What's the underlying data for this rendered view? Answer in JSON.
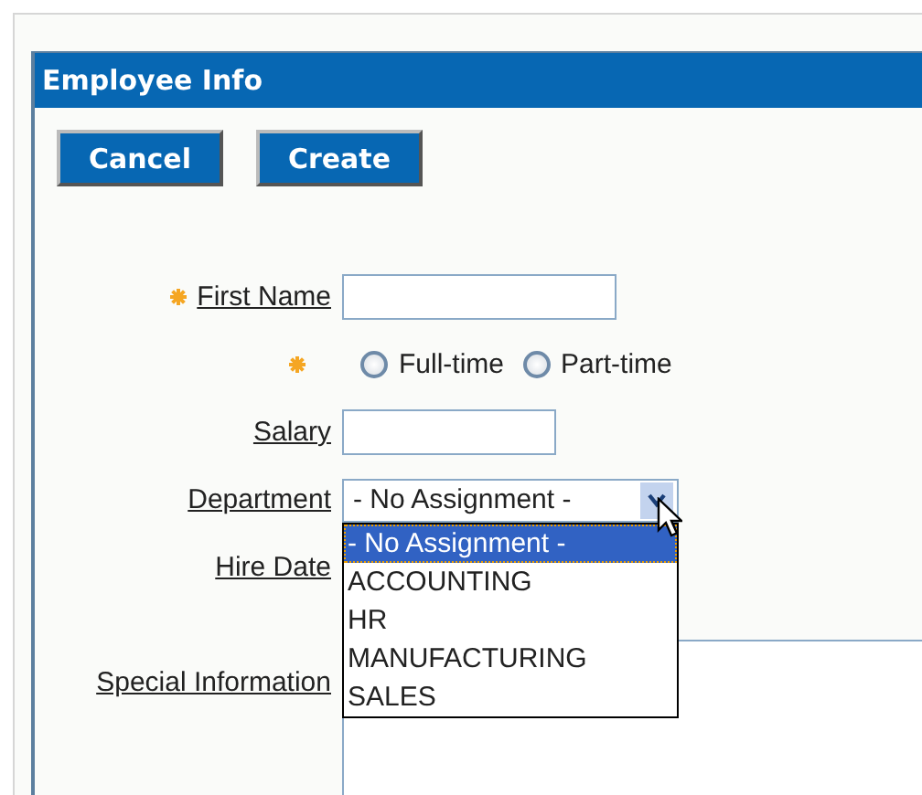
{
  "panel": {
    "title": "Employee Info"
  },
  "buttons": [
    "Cancel",
    "Create"
  ],
  "fields": [
    {
      "kind": "text",
      "label": "First Name",
      "required": true
    },
    {
      "kind": "radio",
      "required": true,
      "options": [
        {
          "label": "Full-time",
          "selected": false
        },
        {
          "label": "Part-time",
          "selected": false
        }
      ]
    },
    {
      "kind": "short",
      "label": "Salary",
      "required": false
    },
    {
      "kind": "select",
      "label": "Department",
      "required": false,
      "value": "- No Assignment -",
      "expanded": true,
      "options": [
        {
          "label": "- No Assignment -",
          "selected": true
        },
        {
          "label": "ACCOUNTING",
          "selected": false
        },
        {
          "label": "HR",
          "selected": false
        },
        {
          "label": "MANUFACTURING",
          "selected": false
        },
        {
          "label": "SALES",
          "selected": false
        }
      ]
    },
    {
      "kind": "label",
      "label": "Hire Date",
      "required": false
    },
    {
      "kind": "textarea",
      "label": "Special Information",
      "required": false
    }
  ]
}
